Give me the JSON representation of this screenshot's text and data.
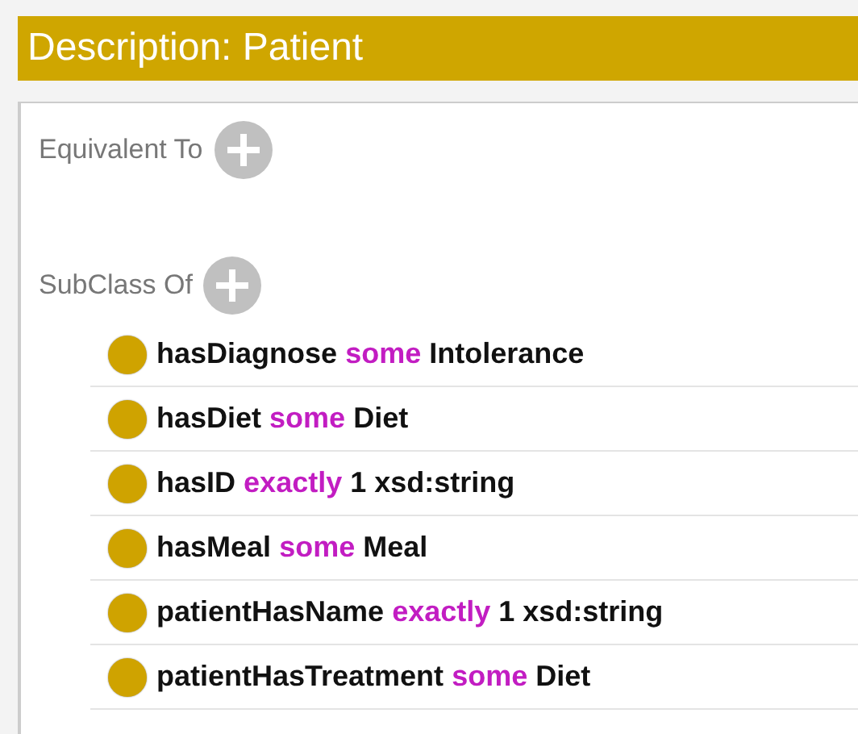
{
  "title": "Description: Patient",
  "sections": [
    {
      "label": "Equivalent To"
    },
    {
      "label": "SubClass Of",
      "axioms": [
        {
          "property": "hasDiagnose",
          "keyword": "some",
          "filler": "Intolerance"
        },
        {
          "property": "hasDiet",
          "keyword": "some",
          "filler": "Diet"
        },
        {
          "property": "hasID",
          "keyword": "exactly",
          "filler": "1 xsd:string"
        },
        {
          "property": "hasMeal",
          "keyword": "some",
          "filler": "Meal"
        },
        {
          "property": "patientHasName",
          "keyword": "exactly",
          "filler": "1 xsd:string"
        },
        {
          "property": "patientHasTreatment",
          "keyword": "some",
          "filler": "Diet"
        }
      ]
    }
  ]
}
